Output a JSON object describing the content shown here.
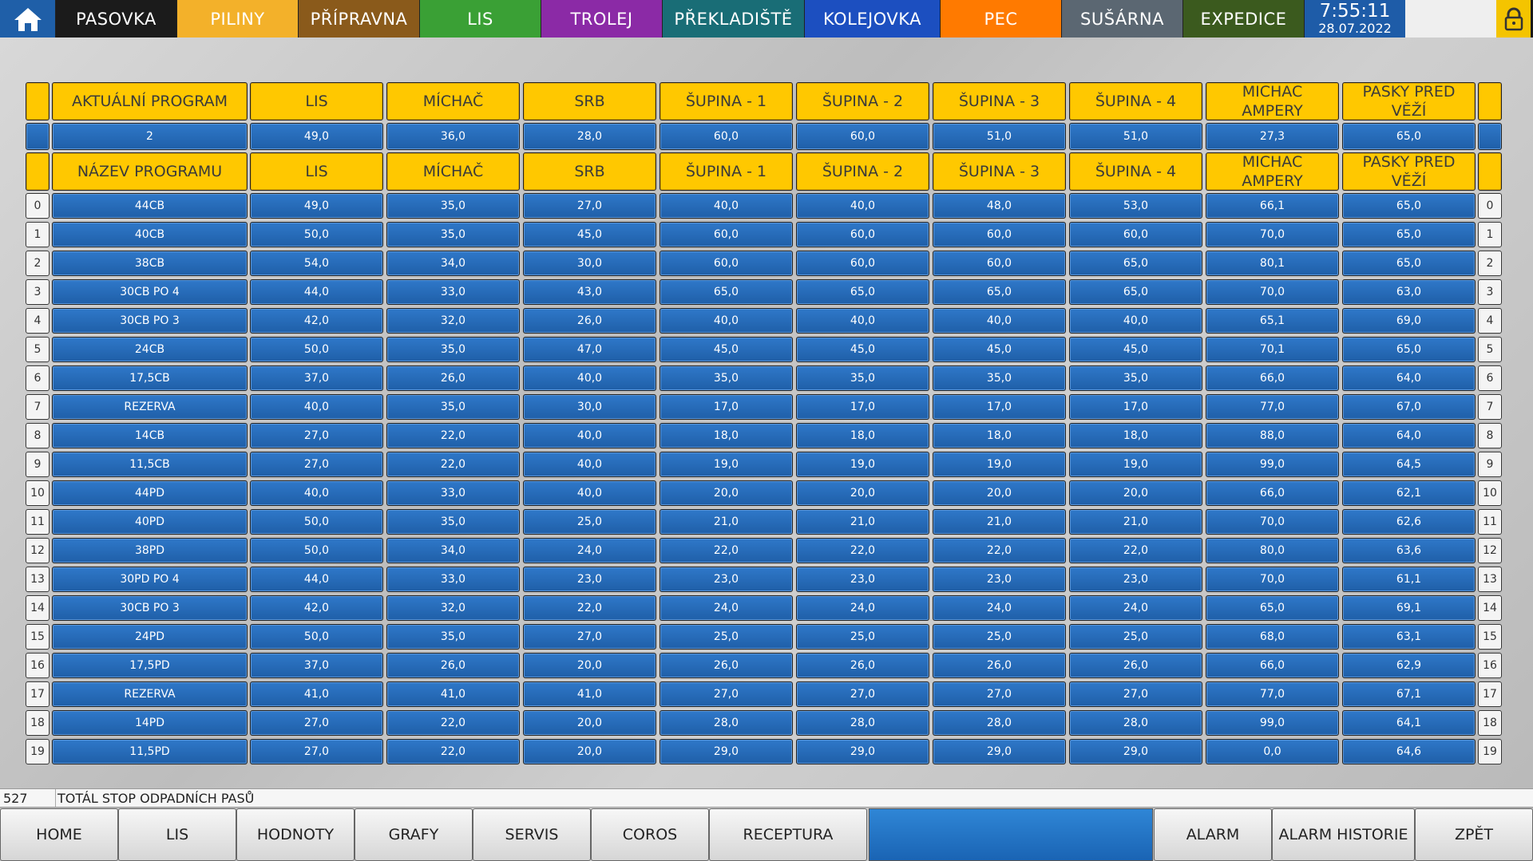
{
  "nav": {
    "items": [
      {
        "label": "PASOVKA",
        "bg": "#1b1b1b",
        "fg": "#ffffff"
      },
      {
        "label": "PILINY",
        "bg": "#f3b12a",
        "fg": "#ffffff"
      },
      {
        "label": "PŘÍPRAVNA",
        "bg": "#8a5a1b",
        "fg": "#ffffff"
      },
      {
        "label": "LIS",
        "bg": "#3aa035",
        "fg": "#ffffff"
      },
      {
        "label": "TROLEJ",
        "bg": "#8b2aa6",
        "fg": "#ffffff"
      },
      {
        "label": "PŘEKLADIŠTĚ",
        "bg": "#196d76",
        "fg": "#ffffff"
      },
      {
        "label": "KOLEJOVKA",
        "bg": "#1c4fc0",
        "fg": "#ffffff"
      },
      {
        "label": "PEC",
        "bg": "#ff7a00",
        "fg": "#ffffff"
      },
      {
        "label": "SUŠÁRNA",
        "bg": "#5b6772",
        "fg": "#ffffff"
      },
      {
        "label": "EXPEDICE",
        "bg": "#3b5a1e",
        "fg": "#ffffff"
      }
    ],
    "time": "7:55:11",
    "date": "28.07.2022"
  },
  "current": {
    "headers": [
      "AKTUÁLNÍ PROGRAM",
      "LIS",
      "MÍCHAČ",
      "SRB",
      "ŠUPINA - 1",
      "ŠUPINA - 2",
      "ŠUPINA - 3",
      "ŠUPINA - 4",
      "MICHAC AMPERY",
      "PASKY PRED VĚŽÍ"
    ],
    "values": [
      "2",
      "49,0",
      "36,0",
      "28,0",
      "60,0",
      "60,0",
      "51,0",
      "51,0",
      "27,3",
      "65,0"
    ]
  },
  "programs": {
    "headers": [
      "NÁZEV PROGRAMU",
      "LIS",
      "MÍCHAČ",
      "SRB",
      "ŠUPINA - 1",
      "ŠUPINA - 2",
      "ŠUPINA - 3",
      "ŠUPINA - 4",
      "MICHAC AMPERY",
      "PASKY PRED VĚŽÍ"
    ],
    "rows": [
      [
        "0",
        "44CB",
        "49,0",
        "35,0",
        "27,0",
        "40,0",
        "40,0",
        "48,0",
        "53,0",
        "66,1",
        "65,0"
      ],
      [
        "1",
        "40CB",
        "50,0",
        "35,0",
        "45,0",
        "60,0",
        "60,0",
        "60,0",
        "60,0",
        "70,0",
        "65,0"
      ],
      [
        "2",
        "38CB",
        "54,0",
        "34,0",
        "30,0",
        "60,0",
        "60,0",
        "60,0",
        "65,0",
        "80,1",
        "65,0"
      ],
      [
        "3",
        "30CB PO 4",
        "44,0",
        "33,0",
        "43,0",
        "65,0",
        "65,0",
        "65,0",
        "65,0",
        "70,0",
        "63,0"
      ],
      [
        "4",
        "30CB PO 3",
        "42,0",
        "32,0",
        "26,0",
        "40,0",
        "40,0",
        "40,0",
        "40,0",
        "65,1",
        "69,0"
      ],
      [
        "5",
        "24CB",
        "50,0",
        "35,0",
        "47,0",
        "45,0",
        "45,0",
        "45,0",
        "45,0",
        "70,1",
        "65,0"
      ],
      [
        "6",
        "17,5CB",
        "37,0",
        "26,0",
        "40,0",
        "35,0",
        "35,0",
        "35,0",
        "35,0",
        "66,0",
        "64,0"
      ],
      [
        "7",
        "REZERVA",
        "40,0",
        "35,0",
        "30,0",
        "17,0",
        "17,0",
        "17,0",
        "17,0",
        "77,0",
        "67,0"
      ],
      [
        "8",
        "14CB",
        "27,0",
        "22,0",
        "40,0",
        "18,0",
        "18,0",
        "18,0",
        "18,0",
        "88,0",
        "64,0"
      ],
      [
        "9",
        "11,5CB",
        "27,0",
        "22,0",
        "40,0",
        "19,0",
        "19,0",
        "19,0",
        "19,0",
        "99,0",
        "64,5"
      ],
      [
        "10",
        "44PD",
        "40,0",
        "33,0",
        "40,0",
        "20,0",
        "20,0",
        "20,0",
        "20,0",
        "66,0",
        "62,1"
      ],
      [
        "11",
        "40PD",
        "50,0",
        "35,0",
        "25,0",
        "21,0",
        "21,0",
        "21,0",
        "21,0",
        "70,0",
        "62,6"
      ],
      [
        "12",
        "38PD",
        "50,0",
        "34,0",
        "24,0",
        "22,0",
        "22,0",
        "22,0",
        "22,0",
        "80,0",
        "63,6"
      ],
      [
        "13",
        "30PD PO 4",
        "44,0",
        "33,0",
        "23,0",
        "23,0",
        "23,0",
        "23,0",
        "23,0",
        "70,0",
        "61,1"
      ],
      [
        "14",
        "30CB PO 3",
        "42,0",
        "32,0",
        "22,0",
        "24,0",
        "24,0",
        "24,0",
        "24,0",
        "65,0",
        "69,1"
      ],
      [
        "15",
        "24PD",
        "50,0",
        "35,0",
        "27,0",
        "25,0",
        "25,0",
        "25,0",
        "25,0",
        "68,0",
        "63,1"
      ],
      [
        "16",
        "17,5PD",
        "37,0",
        "26,0",
        "20,0",
        "26,0",
        "26,0",
        "26,0",
        "26,0",
        "66,0",
        "62,9"
      ],
      [
        "17",
        "REZERVA",
        "41,0",
        "41,0",
        "41,0",
        "27,0",
        "27,0",
        "27,0",
        "27,0",
        "77,0",
        "67,1"
      ],
      [
        "18",
        "14PD",
        "27,0",
        "22,0",
        "20,0",
        "28,0",
        "28,0",
        "28,0",
        "28,0",
        "99,0",
        "64,1"
      ],
      [
        "19",
        "11,5PD",
        "27,0",
        "22,0",
        "20,0",
        "29,0",
        "29,0",
        "29,0",
        "29,0",
        "0,0",
        "64,6"
      ]
    ]
  },
  "status": {
    "code": "527",
    "message": "TOTÁL STOP ODPADNÍCH PASŮ"
  },
  "bottom_nav": {
    "left": [
      "HOME",
      "LIS",
      "HODNOTY",
      "GRAFY",
      "SERVIS",
      "COROS",
      "RECEPTURA"
    ],
    "right": [
      "ALARM",
      "ALARM HISTORIE",
      "ZPĚT"
    ]
  },
  "icons": {
    "home": "home-icon",
    "lock": "lock-icon"
  }
}
